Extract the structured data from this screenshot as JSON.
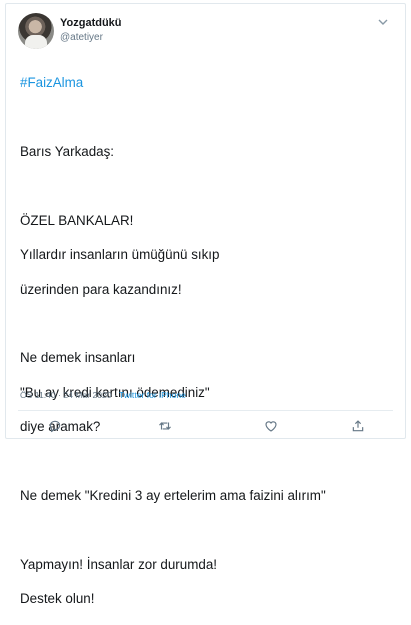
{
  "author": {
    "name": "Yozgatdükü",
    "handle": "@atetiyer"
  },
  "tweet": {
    "hashtag": "#FaizAlma",
    "lines": [
      "",
      "Barıs Yarkadaş:",
      "",
      "ÖZEL BANKALAR!",
      "Yıllardır insanların ümüğünü sıkıp",
      "üzerinden para kazandınız!",
      "",
      "Ne demek insanları",
      "\"Bu ay kredi kartını ödemediniz\"",
      "diye aramak?",
      "",
      "Ne demek \"Kredini 3 ay ertelerim ama faizini alırım\"",
      "",
      "Yapmayın! İnsanlar zor durumda!",
      "Destek olun!"
    ]
  },
  "meta": {
    "timestamp": "ÖS 11:40 · 24 Mar 2020 · ",
    "source": "Twitter for iPhone"
  },
  "icons": {
    "menu": "chevron-down-icon",
    "reply": "reply-icon",
    "retweet": "retweet-icon",
    "like": "heart-icon",
    "share": "share-icon"
  },
  "colors": {
    "link": "#1b95e0",
    "secondary_text": "#657786",
    "icon": "#657786",
    "border": "#e1e8ed"
  }
}
